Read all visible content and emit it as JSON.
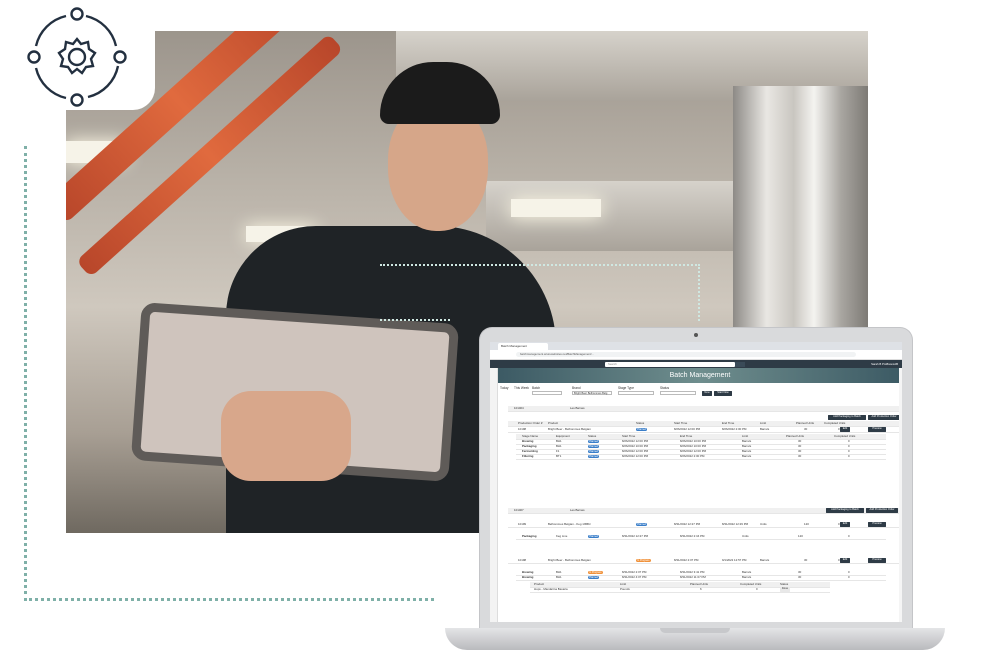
{
  "browser": {
    "tab_title": "Batch Management",
    "url": "batchmanagement.azurewebsites.net/BatchManagement/..."
  },
  "app": {
    "search_placeholder": "Search",
    "user": "Sarah B ProBrewLAB",
    "page_title": "Batch Management"
  },
  "filters": {
    "today": "Today",
    "this_week": "This Week",
    "batch_label": "Batch",
    "brand_label": "Brand",
    "brand_value": "Bright Beer Belhommes Belg",
    "stage_type_label": "Stage Type",
    "status_label": "Status",
    "new_button": "New",
    "start_new_button": "Start New"
  },
  "batches": [
    {
      "batch": "101464",
      "location": "Les Barnes",
      "add_packaging": "Add Packaging to Batch",
      "add_order": "Add Production Order",
      "order_headers": [
        "Production Order #",
        "Product",
        "Status",
        "Start Time",
        "End Time",
        "Limit",
        "Planned Units",
        "Completed Units"
      ],
      "order": {
        "num": "10198",
        "product": "Bright Beer - Belhommes Belgian",
        "status": "Planned",
        "start": "8/26/2022 12:00 PM",
        "end": "8/26/2022 2:00 PM",
        "limit": "Barrels",
        "planned": "30",
        "completed": "0"
      },
      "edit": "Edit",
      "preview": "Preview",
      "stage_headers": [
        "Stage Name",
        "Equipment",
        "Status",
        "Start Time",
        "End Time",
        "Limit",
        "Planned Units",
        "Completed Units"
      ],
      "stages": [
        {
          "name": "Brewing",
          "equip": "BH1",
          "status": "Planned",
          "start": "8/26/2022 12:00 PM",
          "end": "8/26/2022 10:00 PM",
          "limit": "Barrels",
          "planned": "30",
          "completed": "0"
        },
        {
          "name": "Packaging",
          "equip": "BH1",
          "status": "Planned",
          "start": "8/26/2022 10:00 PM",
          "end": "8/26/2022 10:00 PM",
          "limit": "Barrels",
          "planned": "30",
          "completed": "0"
        },
        {
          "name": "Fermenting",
          "equip": "F1",
          "status": "Planned",
          "start": "8/26/2022 12:00 PM",
          "end": "8/26/2022 12:00 PM",
          "limit": "Barrels",
          "planned": "30",
          "completed": "0"
        },
        {
          "name": "Filtering",
          "equip": "BT1",
          "status": "Planned",
          "start": "8/26/2022 12:00 PM",
          "end": "8/26/2022 2:00 PM",
          "limit": "Barrels",
          "planned": "30",
          "completed": "0"
        }
      ]
    },
    {
      "batch": "101467",
      "location": "Les Barnes",
      "add_packaging": "Add Packaging to Batch",
      "add_order": "Add Production Order",
      "order": {
        "num": "10199",
        "product": "Belhommes Belgian - Keg 1/6Bbl",
        "status": "Planned",
        "start": "8/31/2022 12:27 PM",
        "end": "8/31/2022 12:29 PM",
        "limit": "Units",
        "planned": "120",
        "completed": "0"
      },
      "stage": {
        "name": "Packaging",
        "equip": "Keg Line",
        "status": "Planned",
        "start": "8/31/2022 12:27 PM",
        "end": "8/31/2022 2:16 PM",
        "limit": "Units",
        "planned": "120",
        "completed": "0"
      },
      "order2": {
        "num": "10198",
        "product": "Bright Beer - Belhommes Belgian",
        "status": "In Progress",
        "start": "8/31/2022 2:07 PM",
        "end": "9/1/2022 12:57 PM",
        "limit": "Barrels",
        "planned": "30",
        "completed": "0"
      },
      "stages2": [
        {
          "name": "Brewing",
          "equip": "BH1",
          "status": "In Progress",
          "start": "8/31/2022 2:07 PM",
          "end": "8/31/2022 3:41 PM",
          "limit": "Barrels",
          "planned": "30",
          "completed": "0"
        },
        {
          "name": "Brewing",
          "equip": "BH1",
          "status": "Planned",
          "start": "8/31/2022 4:07 PM",
          "end": "8/31/2022 11:07 PM",
          "limit": "Barrels",
          "planned": "30",
          "completed": "0"
        }
      ],
      "ingredient_headers": [
        "Product",
        "Limit",
        "Planned Units",
        "Completed Units",
        "Status"
      ],
      "ingredient": {
        "product": "Hops - Mandarina Bavaria",
        "limit": "Pounds",
        "planned": "6",
        "completed": "0",
        "action": "Done"
      }
    }
  ],
  "colors": {
    "accent": "#2e3b46",
    "planned": "#3a7ec9",
    "in_progress": "#f0913a",
    "dotted_line": "#7fb0a8",
    "icon": "#233040"
  }
}
